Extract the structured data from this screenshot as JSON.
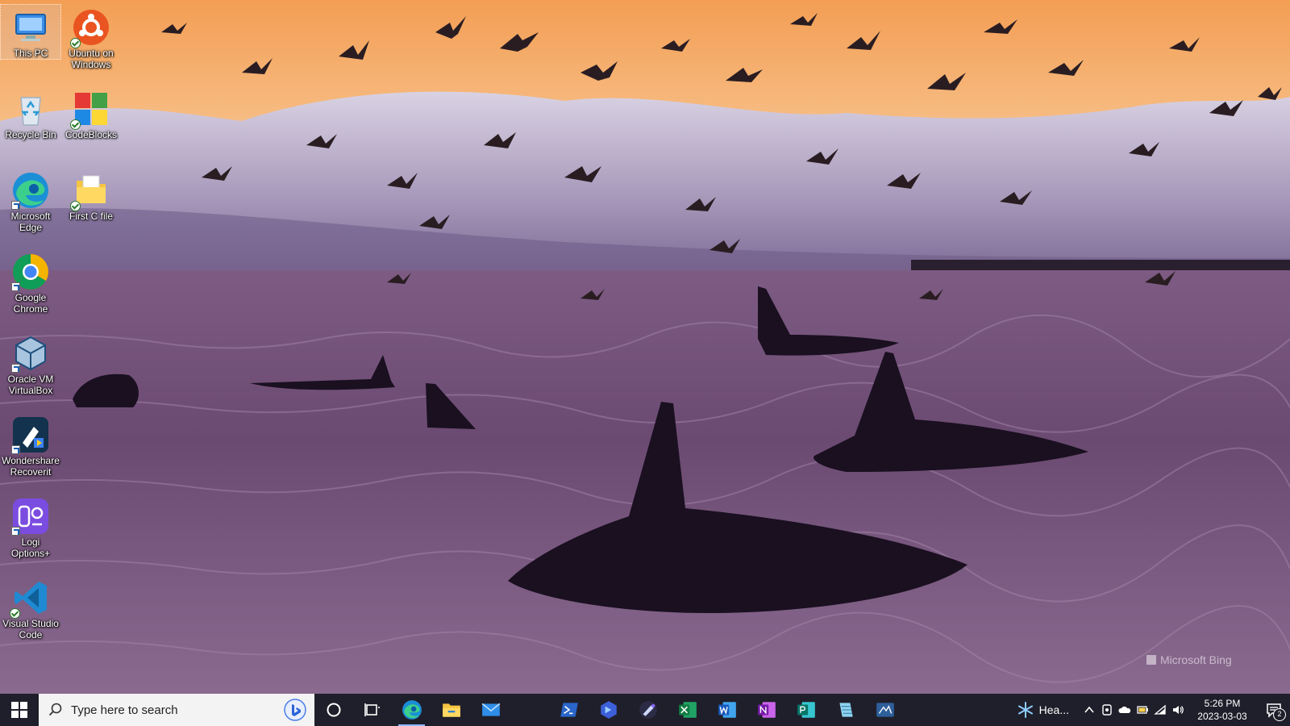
{
  "desktop": {
    "icons": [
      {
        "label": "This PC",
        "icon": "this-pc-icon"
      },
      {
        "label": "Ubuntu on Windows",
        "icon": "ubuntu-icon"
      },
      {
        "label": "Recycle Bin",
        "icon": "recycle-bin-icon"
      },
      {
        "label": "CodeBlocks",
        "icon": "codeblocks-icon"
      },
      {
        "label": "Microsoft Edge",
        "icon": "edge-icon"
      },
      {
        "label": "First C file",
        "icon": "folder-icon"
      },
      {
        "label": "Google Chrome",
        "icon": "chrome-icon"
      },
      {
        "label": "Oracle VM VirtualBox",
        "icon": "virtualbox-icon"
      },
      {
        "label": "Wondershare Recoverit",
        "icon": "recoverit-icon"
      },
      {
        "label": "Logi Options+",
        "icon": "logi-options-icon"
      },
      {
        "label": "Visual Studio Code",
        "icon": "vscode-icon"
      }
    ],
    "watermark": "Microsoft Bing"
  },
  "taskbar": {
    "search_placeholder": "Type here to search",
    "apps": [
      {
        "name": "Microsoft Edge",
        "icon": "edge-icon"
      },
      {
        "name": "File Explorer",
        "icon": "file-explorer-icon"
      },
      {
        "name": "Mail",
        "icon": "mail-icon"
      },
      {
        "name": "PowerShell",
        "icon": "powershell-icon"
      },
      {
        "name": "Power Automate",
        "icon": "power-automate-icon"
      },
      {
        "name": "Visual Studio Installer",
        "icon": "vs-installer-icon"
      },
      {
        "name": "Excel",
        "icon": "excel-icon"
      },
      {
        "name": "Word",
        "icon": "word-icon"
      },
      {
        "name": "OneNote",
        "icon": "onenote-icon"
      },
      {
        "name": "Publisher",
        "icon": "publisher-icon"
      },
      {
        "name": "Notepad",
        "icon": "notepad-icon"
      },
      {
        "name": "Snipping Tool",
        "icon": "snipping-tool-icon"
      }
    ],
    "weather_text": "Hea...",
    "clock_time": "5:26 PM",
    "clock_date": "2023-03-03",
    "notification_count": "2"
  },
  "colors": {
    "taskbar": "#1f1f2b",
    "sky_top": "#f4a25a",
    "water": "#6a4a70"
  }
}
